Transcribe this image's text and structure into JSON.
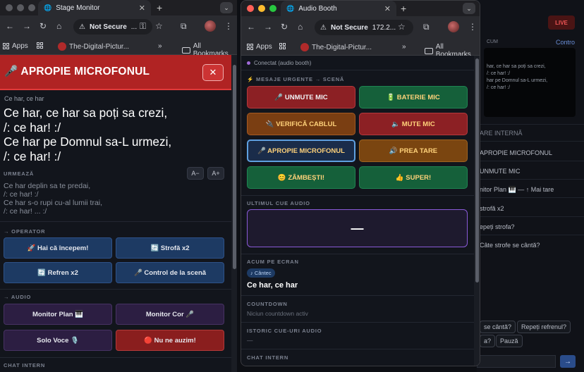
{
  "browser": {
    "not_secure": "Not Secure",
    "omnibox_ellipsis": "...",
    "booth_url": "172.2...",
    "bookmarks": {
      "apps": "Apps",
      "site": "The-Digital-Pictur...",
      "more": "»",
      "all": "All Bookmarks"
    }
  },
  "stage_window": {
    "tab_title": "Stage Monitor",
    "alert_title": "🎤 APROPIE MICROFONUL",
    "close_label": "✕",
    "song_title": "Ce har, ce har",
    "lyrics_current": [
      "Ce har, ce har sa poți sa crezi,",
      "/: ce har! :/",
      "Ce har pe Domnul sa-L urmezi,",
      "/: ce har! :/"
    ],
    "next_label": "URMEAZĂ",
    "lyrics_next": [
      "Ce har deplin sa te predai,",
      "/: ce har! :/",
      "Ce har s-o rupi cu-al lumii trai,",
      "/: ce har! ... :/"
    ],
    "font_decrease": "A−",
    "font_increase": "A+",
    "operator_label": "→ OPERATOR",
    "operator_buttons": [
      "🚀 Hai că începem!",
      "🔄 Strofă x2",
      "🔄 Refren x2",
      "🎤 Control de la scenă"
    ],
    "audio_label": "→ AUDIO",
    "audio_buttons": [
      "Monitor Plan 🎹",
      "Monitor Cor 🎤",
      "Solo Voce 🎙️",
      "🔴 Nu ne auzim!"
    ],
    "chat_label": "CHAT INTERN"
  },
  "booth_window": {
    "tab_title": "Audio Booth",
    "connection": "Conectat (audio booth)",
    "urgent_label": "⚡ MESAJE URGENTE → SCENĂ",
    "buttons": [
      "🎤 UNMUTE MIC",
      "🔋 BATERIE MIC",
      "🔌 VERIFICĂ CABLUL",
      "🔈 MUTE MIC",
      "🎤 APROPIE MICROFONUL",
      "🔊 PREA TARE",
      "😊 ZÂMBEȘTI!",
      "👍 SUPER!"
    ],
    "last_cue_label": "ULTIMUL CUE AUDIO",
    "last_cue_value": "—",
    "on_screen_label": "ACUM PE ECRAN",
    "on_screen_badge": "♪ Cântec",
    "on_screen_title": "Ce har, ce har",
    "countdown_label": "COUNTDOWN",
    "countdown_value": "Niciun countdown activ",
    "history_label": "ISTORIC CUE-URI AUDIO",
    "history_value": "—",
    "chat_label": "CHAT INTERN"
  },
  "background_window": {
    "live": "LIVE",
    "cum": "CUM",
    "control": "Contro",
    "preview_lines": [
      "har, ce har sa poți sa crezi,",
      "/: ce har! :/",
      "har pe Domnul sa-L urmezi,",
      "/: ce har! :/"
    ],
    "internal_label": "ARE INTERNĂ",
    "items": [
      "APROPIE MICROFONUL",
      "UNMUTE MIC",
      "nitor Plan 🎹 — ↑ Mai tare",
      "strofă x2",
      "epeți strofa?",
      "Câte strofe se cântă?"
    ],
    "pills": [
      "se cântă?",
      "Repeți refrenul?",
      "a?",
      "Pauză"
    ]
  }
}
